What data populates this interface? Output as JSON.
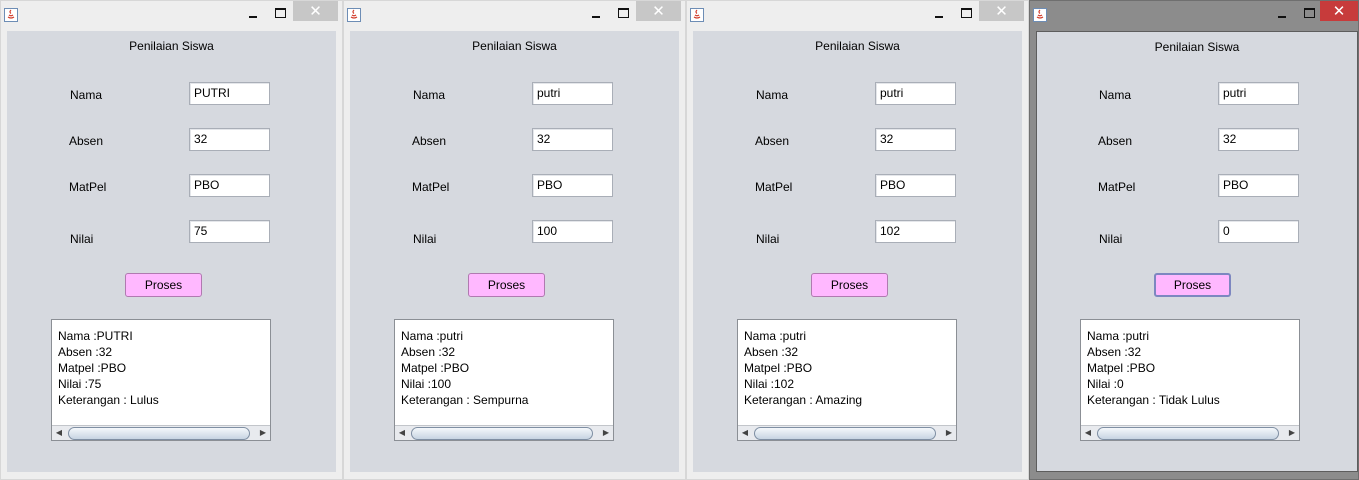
{
  "windows": [
    {
      "close_symbol": "✕",
      "title": "Penilaian Siswa",
      "labels": {
        "nama": "Nama",
        "absen": "Absen",
        "matpel": "MatPel",
        "nilai": "Nilai"
      },
      "fields": {
        "nama": "PUTRI",
        "absen": "32",
        "matpel": "PBO",
        "nilai": "75"
      },
      "button": "Proses",
      "output": [
        "Nama :PUTRI",
        "Absen :32",
        "Matpel :PBO",
        "Nilai :75",
        "Keterangan : Lulus"
      ]
    },
    {
      "close_symbol": "✕",
      "title": "Penilaian Siswa",
      "labels": {
        "nama": "Nama",
        "absen": "Absen",
        "matpel": "MatPel",
        "nilai": "Nilai"
      },
      "fields": {
        "nama": "putri",
        "absen": "32",
        "matpel": "PBO",
        "nilai": "100"
      },
      "button": "Proses",
      "output": [
        "Nama :putri",
        "Absen :32",
        "Matpel :PBO",
        "Nilai :100",
        "Keterangan : Sempurna"
      ]
    },
    {
      "close_symbol": "✕",
      "title": "Penilaian Siswa",
      "labels": {
        "nama": "Nama",
        "absen": "Absen",
        "matpel": "MatPel",
        "nilai": "Nilai"
      },
      "fields": {
        "nama": "putri",
        "absen": "32",
        "matpel": "PBO",
        "nilai": "102"
      },
      "button": "Proses",
      "output": [
        "Nama :putri",
        "Absen :32",
        "Matpel :PBO",
        "Nilai :102",
        "Keterangan : Amazing"
      ]
    },
    {
      "close_symbol": "✕",
      "title": "Penilaian Siswa",
      "labels": {
        "nama": "Nama",
        "absen": "Absen",
        "matpel": "MatPel",
        "nilai": "Nilai"
      },
      "fields": {
        "nama": "putri",
        "absen": "32",
        "matpel": "PBO",
        "nilai": "0"
      },
      "button": "Proses",
      "output": [
        "Nama :putri",
        "Absen :32",
        "Matpel :PBO",
        "Nilai :0",
        "Keterangan : Tidak Lulus"
      ]
    }
  ],
  "scroll_arrows": {
    "left": "◀",
    "right": "▶"
  },
  "colors": {
    "panel": "#d6d9df",
    "button": "#ffb8ff",
    "close_active": "#c73b3b"
  }
}
